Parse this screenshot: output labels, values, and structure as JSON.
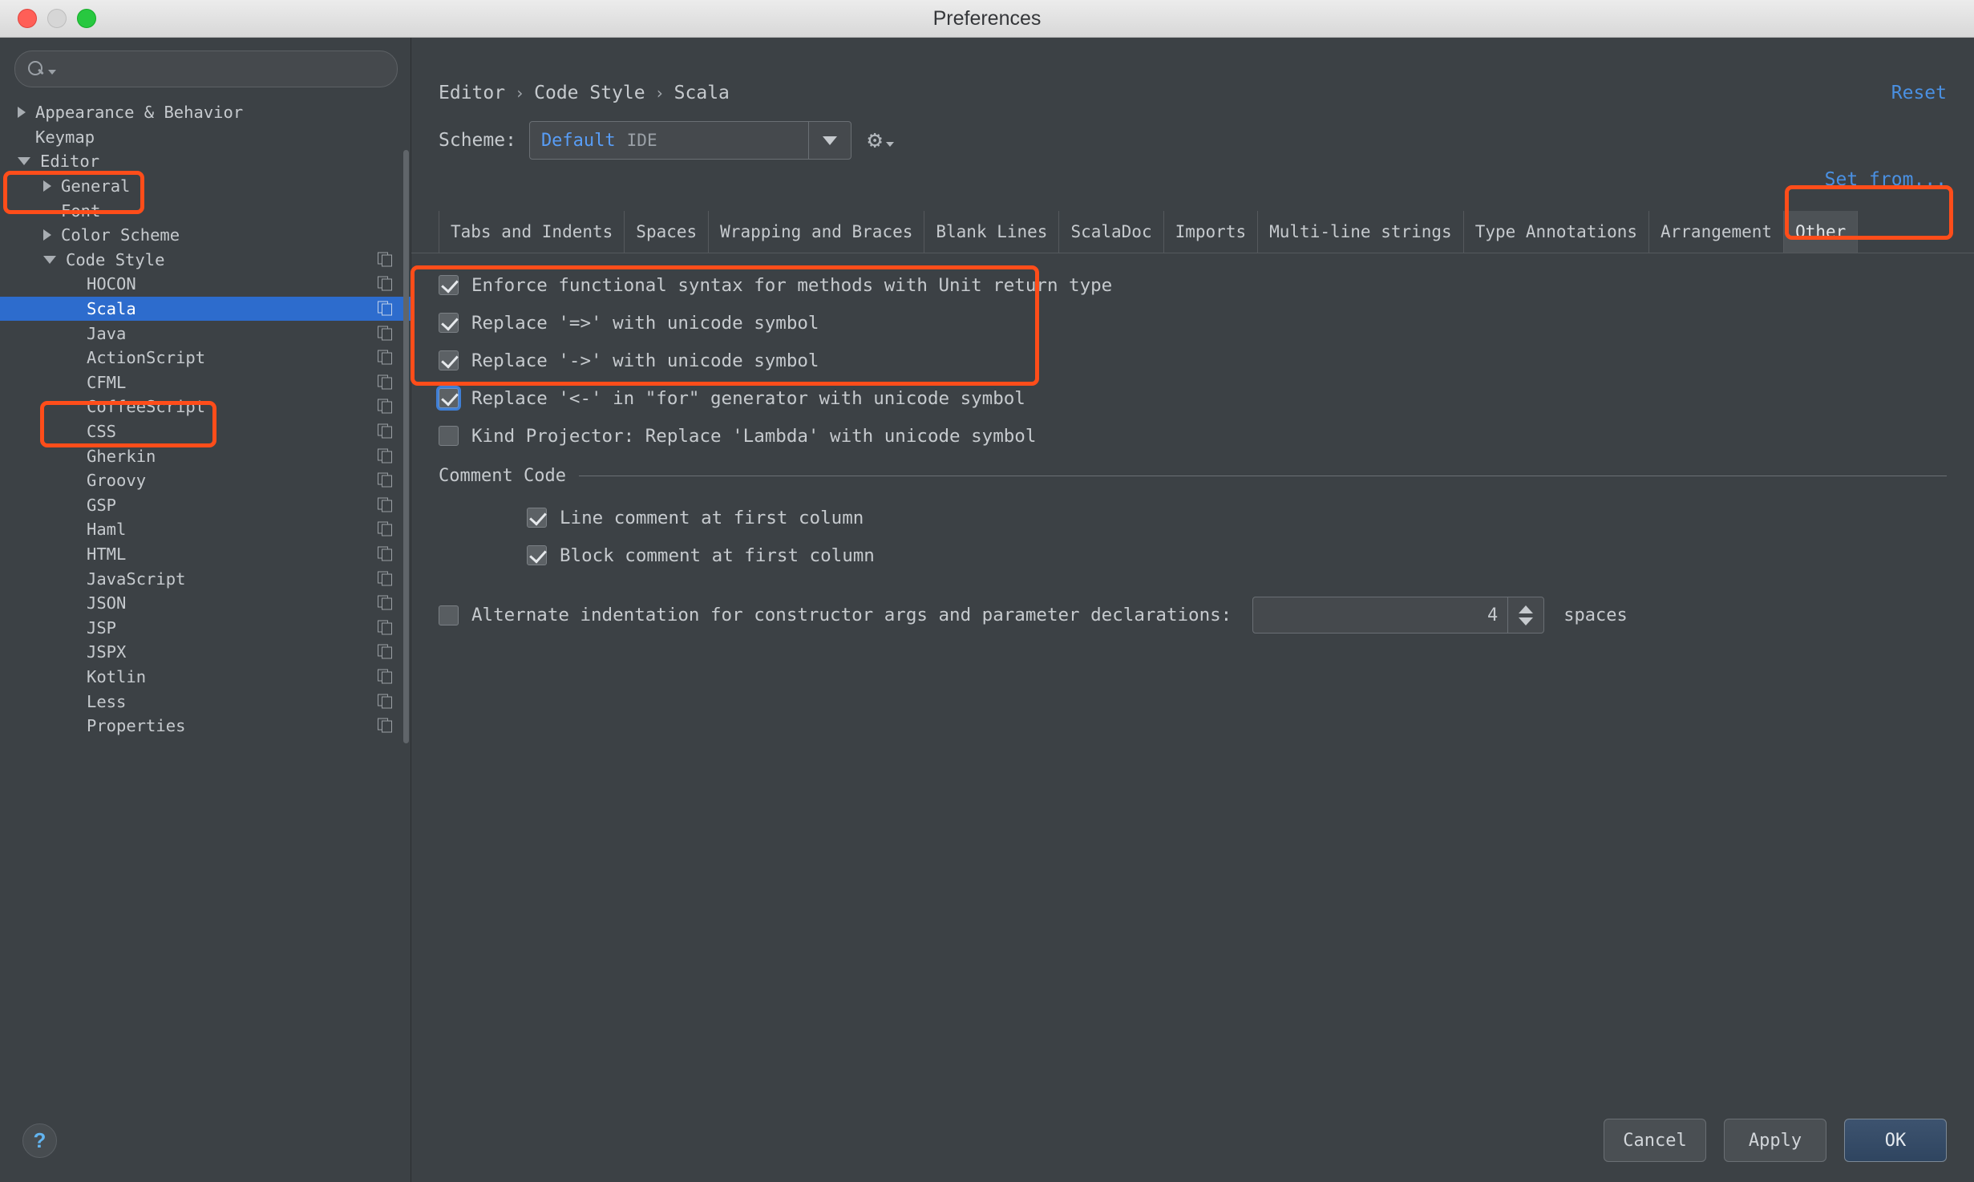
{
  "window": {
    "title": "Preferences"
  },
  "titlebar": {
    "close": "close-button",
    "minimize": "minimize-button",
    "zoom": "zoom-button"
  },
  "sidebar": {
    "search": {
      "value": "",
      "placeholder": ""
    },
    "items": [
      {
        "label": "Appearance & Behavior",
        "indent": 0,
        "arrow": "right",
        "copy": false,
        "selected": false
      },
      {
        "label": "Keymap",
        "indent": 0,
        "arrow": "none",
        "copy": false,
        "selected": false
      },
      {
        "label": "Editor",
        "indent": 0,
        "arrow": "down",
        "copy": false,
        "selected": false
      },
      {
        "label": "General",
        "indent": 1,
        "arrow": "right",
        "copy": false,
        "selected": false
      },
      {
        "label": "Font",
        "indent": 1,
        "arrow": "none",
        "copy": false,
        "selected": false
      },
      {
        "label": "Color Scheme",
        "indent": 1,
        "arrow": "right",
        "copy": false,
        "selected": false
      },
      {
        "label": "Code Style",
        "indent": 1,
        "arrow": "down",
        "copy": true,
        "selected": false
      },
      {
        "label": "HOCON",
        "indent": 2,
        "arrow": "none",
        "copy": true,
        "selected": false
      },
      {
        "label": "Scala",
        "indent": 2,
        "arrow": "none",
        "copy": true,
        "selected": true
      },
      {
        "label": "Java",
        "indent": 2,
        "arrow": "none",
        "copy": true,
        "selected": false
      },
      {
        "label": "ActionScript",
        "indent": 2,
        "arrow": "none",
        "copy": true,
        "selected": false
      },
      {
        "label": "CFML",
        "indent": 2,
        "arrow": "none",
        "copy": true,
        "selected": false
      },
      {
        "label": "CoffeeScript",
        "indent": 2,
        "arrow": "none",
        "copy": true,
        "selected": false
      },
      {
        "label": "CSS",
        "indent": 2,
        "arrow": "none",
        "copy": true,
        "selected": false
      },
      {
        "label": "Gherkin",
        "indent": 2,
        "arrow": "none",
        "copy": true,
        "selected": false
      },
      {
        "label": "Groovy",
        "indent": 2,
        "arrow": "none",
        "copy": true,
        "selected": false
      },
      {
        "label": "GSP",
        "indent": 2,
        "arrow": "none",
        "copy": true,
        "selected": false
      },
      {
        "label": "Haml",
        "indent": 2,
        "arrow": "none",
        "copy": true,
        "selected": false
      },
      {
        "label": "HTML",
        "indent": 2,
        "arrow": "none",
        "copy": true,
        "selected": false
      },
      {
        "label": "JavaScript",
        "indent": 2,
        "arrow": "none",
        "copy": true,
        "selected": false
      },
      {
        "label": "JSON",
        "indent": 2,
        "arrow": "none",
        "copy": true,
        "selected": false
      },
      {
        "label": "JSP",
        "indent": 2,
        "arrow": "none",
        "copy": true,
        "selected": false
      },
      {
        "label": "JSPX",
        "indent": 2,
        "arrow": "none",
        "copy": true,
        "selected": false
      },
      {
        "label": "Kotlin",
        "indent": 2,
        "arrow": "none",
        "copy": true,
        "selected": false
      },
      {
        "label": "Less",
        "indent": 2,
        "arrow": "none",
        "copy": true,
        "selected": false
      },
      {
        "label": "Properties",
        "indent": 2,
        "arrow": "none",
        "copy": true,
        "selected": false
      }
    ],
    "help_label": "?"
  },
  "main": {
    "breadcrumb": [
      "Editor",
      "Code Style",
      "Scala"
    ],
    "breadcrumb_separator": "›",
    "reset_label": "Reset",
    "set_from_label": "Set from...",
    "scheme": {
      "label": "Scheme:",
      "value": "Default",
      "scope": "IDE"
    },
    "tabs": [
      {
        "label": "Tabs and Indents",
        "active": false
      },
      {
        "label": "Spaces",
        "active": false
      },
      {
        "label": "Wrapping and Braces",
        "active": false
      },
      {
        "label": "Blank Lines",
        "active": false
      },
      {
        "label": "ScalaDoc",
        "active": false
      },
      {
        "label": "Imports",
        "active": false
      },
      {
        "label": "Multi-line strings",
        "active": false
      },
      {
        "label": "Type Annotations",
        "active": false
      },
      {
        "label": "Arrangement",
        "active": false
      },
      {
        "label": "Other",
        "active": true
      }
    ],
    "options": [
      {
        "label": "Enforce functional syntax for methods with Unit return type",
        "checked": true,
        "focused": false
      },
      {
        "label": "Replace '=>' with unicode symbol",
        "checked": true,
        "focused": false
      },
      {
        "label": "Replace '->' with unicode symbol",
        "checked": true,
        "focused": false
      },
      {
        "label": "Replace '<-' in \"for\" generator with unicode symbol",
        "checked": true,
        "focused": true
      },
      {
        "label": "Kind Projector: Replace 'Lambda' with unicode symbol",
        "checked": false,
        "focused": false
      }
    ],
    "comment_section": {
      "title": "Comment Code",
      "options": [
        {
          "label": "Line comment at first column",
          "checked": true
        },
        {
          "label": "Block comment at first column",
          "checked": true
        }
      ]
    },
    "alternate": {
      "label": "Alternate indentation for constructor args and parameter declarations:",
      "checked": false,
      "value": "4",
      "units": "spaces"
    }
  },
  "footer": {
    "cancel_label": "Cancel",
    "apply_label": "Apply",
    "ok_label": "OK"
  },
  "annotations": {
    "color": "#ff4d1a",
    "boxes": [
      {
        "name": "editor-tree-item-highlight"
      },
      {
        "name": "scala-tree-item-highlight"
      },
      {
        "name": "unicode-replace-options-highlight"
      },
      {
        "name": "other-tab-highlight"
      }
    ]
  }
}
